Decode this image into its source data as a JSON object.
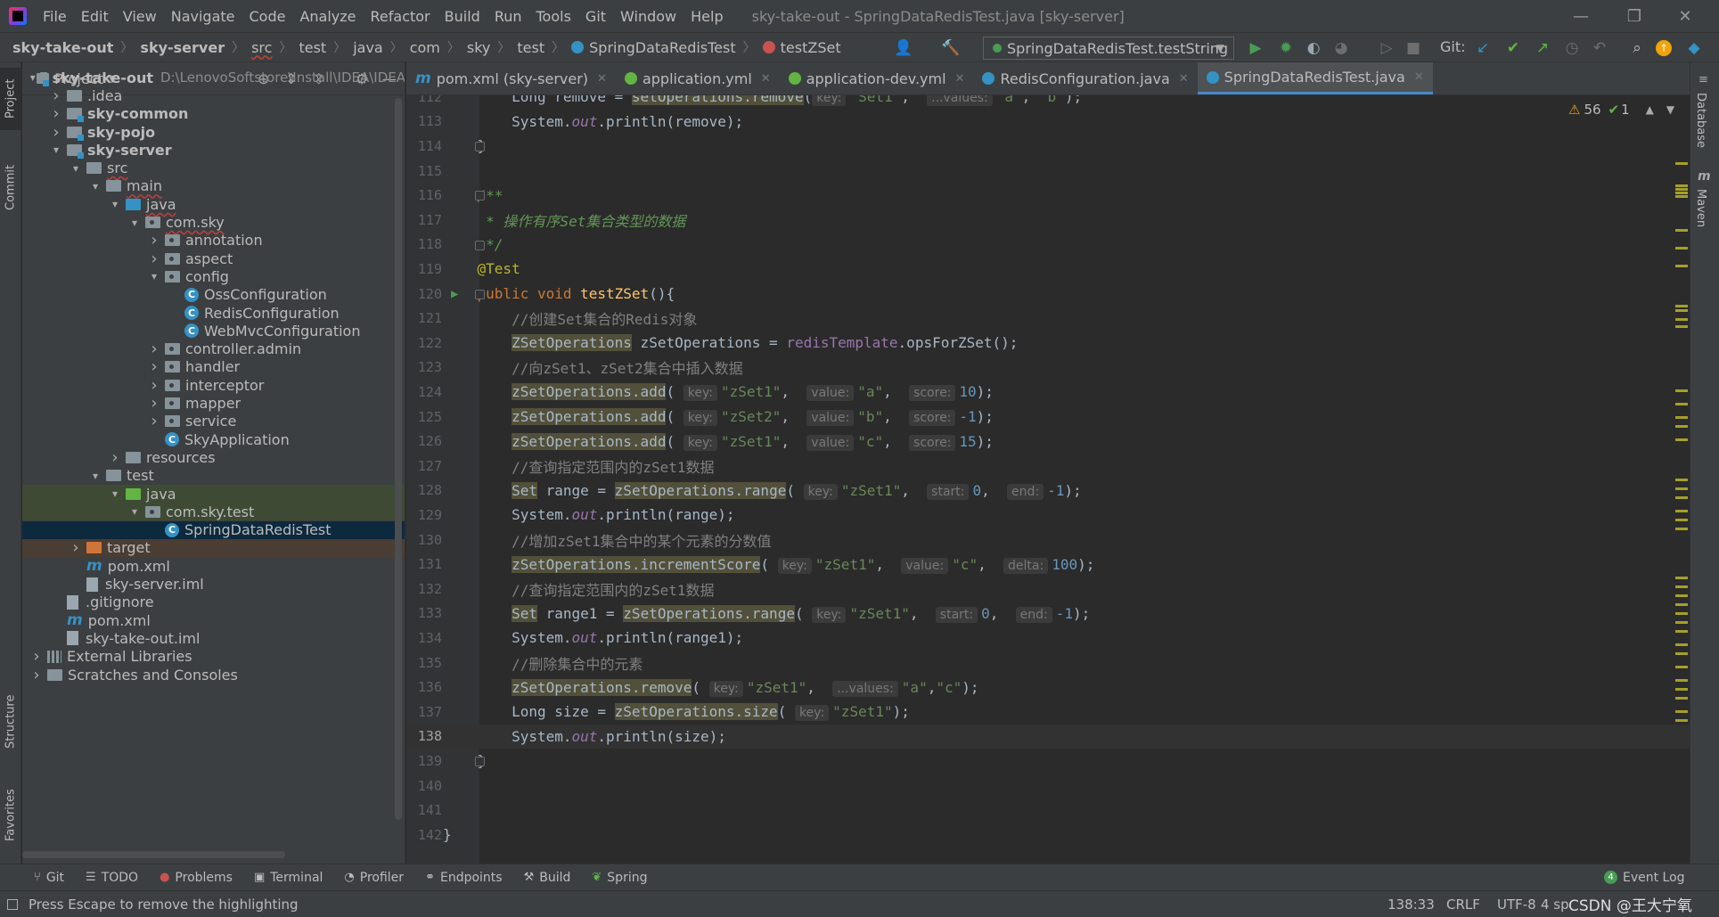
{
  "menubar": {
    "items": [
      "File",
      "Edit",
      "View",
      "Navigate",
      "Code",
      "Analyze",
      "Refactor",
      "Build",
      "Run",
      "Tools",
      "Git",
      "Window",
      "Help"
    ],
    "title": "sky-take-out - SpringDataRedisTest.java [sky-server]"
  },
  "breadcrumb": [
    "sky-take-out",
    "sky-server",
    "src",
    "test",
    "java",
    "com",
    "sky",
    "test",
    "SpringDataRedisTest",
    "testZSet"
  ],
  "toolbar": {
    "run_config": "SpringDataRedisTest.testString",
    "git_label": "Git:"
  },
  "project": {
    "header": "Project",
    "tree": [
      {
        "label": "sky-take-out",
        "extra": "D:\\LenovoSoftstore\\Install\\IDEA\\IDEA",
        "depth": 0,
        "arrow": "down",
        "icon": "module",
        "bold": true
      },
      {
        "label": ".idea",
        "depth": 1,
        "arrow": "right",
        "icon": "plain"
      },
      {
        "label": "sky-common",
        "depth": 1,
        "arrow": "right",
        "icon": "module",
        "bold": true
      },
      {
        "label": "sky-pojo",
        "depth": 1,
        "arrow": "right",
        "icon": "module",
        "bold": true
      },
      {
        "label": "sky-server",
        "depth": 1,
        "arrow": "down",
        "icon": "module",
        "bold": true
      },
      {
        "label": "src",
        "depth": 2,
        "arrow": "down",
        "icon": "plain"
      },
      {
        "label": "main",
        "depth": 3,
        "arrow": "down",
        "icon": "plain"
      },
      {
        "label": "java",
        "depth": 4,
        "arrow": "down",
        "icon": "blue"
      },
      {
        "label": "com.sky",
        "depth": 5,
        "arrow": "down",
        "icon": "pkg"
      },
      {
        "label": "annotation",
        "depth": 6,
        "arrow": "right",
        "icon": "pkg"
      },
      {
        "label": "aspect",
        "depth": 6,
        "arrow": "right",
        "icon": "pkg"
      },
      {
        "label": "config",
        "depth": 6,
        "arrow": "down",
        "icon": "pkg"
      },
      {
        "label": "OssConfiguration",
        "depth": 7,
        "icon": "class"
      },
      {
        "label": "RedisConfiguration",
        "depth": 7,
        "icon": "class"
      },
      {
        "label": "WebMvcConfiguration",
        "depth": 7,
        "icon": "class"
      },
      {
        "label": "controller.admin",
        "depth": 6,
        "arrow": "right",
        "icon": "pkg"
      },
      {
        "label": "handler",
        "depth": 6,
        "arrow": "right",
        "icon": "pkg"
      },
      {
        "label": "interceptor",
        "depth": 6,
        "arrow": "right",
        "icon": "pkg"
      },
      {
        "label": "mapper",
        "depth": 6,
        "arrow": "right",
        "icon": "pkg"
      },
      {
        "label": "service",
        "depth": 6,
        "arrow": "right",
        "icon": "pkg"
      },
      {
        "label": "SkyApplication",
        "depth": 6,
        "icon": "class"
      },
      {
        "label": "resources",
        "depth": 4,
        "arrow": "right",
        "icon": "plain"
      },
      {
        "label": "test",
        "depth": 3,
        "arrow": "down",
        "icon": "plain"
      },
      {
        "label": "java",
        "depth": 4,
        "arrow": "down",
        "icon": "green",
        "tint": "green"
      },
      {
        "label": "com.sky.test",
        "depth": 5,
        "arrow": "down",
        "icon": "pkg",
        "tint": "green"
      },
      {
        "label": "SpringDataRedisTest",
        "depth": 6,
        "icon": "class",
        "tint": "selected"
      },
      {
        "label": "target",
        "depth": 2,
        "arrow": "right",
        "icon": "orange",
        "tint": "orange"
      },
      {
        "label": "pom.xml",
        "depth": 2,
        "icon": "m"
      },
      {
        "label": "sky-server.iml",
        "depth": 2,
        "icon": "file"
      },
      {
        "label": ".gitignore",
        "depth": 1,
        "icon": "file"
      },
      {
        "label": "pom.xml",
        "depth": 1,
        "icon": "m"
      },
      {
        "label": "sky-take-out.iml",
        "depth": 1,
        "icon": "file"
      },
      {
        "label": "External Libraries",
        "depth": 0,
        "arrow": "right",
        "icon": "lib"
      },
      {
        "label": "Scratches and Consoles",
        "depth": 0,
        "arrow": "right",
        "icon": "scratch"
      }
    ]
  },
  "tabs": [
    {
      "label": "pom.xml (sky-server)",
      "icon": "m",
      "active": false
    },
    {
      "label": "application.yml",
      "icon": "yml",
      "active": false
    },
    {
      "label": "application-dev.yml",
      "icon": "yml",
      "active": false
    },
    {
      "label": "RedisConfiguration.java",
      "icon": "class",
      "active": false
    },
    {
      "label": "SpringDataRedisTest.java",
      "icon": "class",
      "active": true
    }
  ],
  "editor": {
    "warnings": "56",
    "checks": "1",
    "lines": [
      {
        "n": "112",
        "parts": [
          [
            "",
            "        Long remove = "
          ],
          [
            "hl",
            "setOperations.remove"
          ],
          [
            "",
            "("
          ],
          [
            "hint",
            "key:"
          ],
          [
            "str",
            "\"Set1\""
          ],
          [
            "",
            ",  "
          ],
          [
            "hint",
            "...values:"
          ],
          [
            "str",
            "\"a\""
          ],
          [
            "",
            ", "
          ],
          [
            "str",
            "\"b\""
          ],
          [
            "",
            ");"
          ]
        ]
      },
      {
        "n": "113",
        "parts": [
          [
            "",
            "        System."
          ],
          [
            "ital",
            "out"
          ],
          [
            "",
            ".println(remove);"
          ]
        ]
      },
      {
        "n": "114",
        "parts": [
          [
            "",
            "    }"
          ]
        ]
      },
      {
        "n": "115",
        "parts": []
      },
      {
        "n": "116",
        "parts": [
          [
            "doc",
            "    /**"
          ]
        ]
      },
      {
        "n": "117",
        "parts": [
          [
            "doc",
            "     * 操作有序Set集合类型的数据"
          ]
        ]
      },
      {
        "n": "118",
        "parts": [
          [
            "doc",
            "     */"
          ]
        ]
      },
      {
        "n": "119",
        "parts": [
          [
            "ann",
            "    @Test"
          ]
        ]
      },
      {
        "n": "120",
        "parts": [
          [
            "kw",
            "    public void "
          ],
          [
            "fnd",
            "testZSet"
          ],
          [
            "",
            "(){"
          ]
        ]
      },
      {
        "n": "121",
        "parts": [
          [
            "cmt",
            "        //创建Set集合的Redis对象"
          ]
        ]
      },
      {
        "n": "122",
        "parts": [
          [
            "",
            "        "
          ],
          [
            "hl",
            "ZSetOperations"
          ],
          [
            "",
            " zSetOperations = "
          ],
          [
            "fld",
            "redisTemplate"
          ],
          [
            "",
            ".opsForZSet();"
          ]
        ]
      },
      {
        "n": "123",
        "parts": [
          [
            "cmt",
            "        //向zSet1、zSet2集合中插入数据"
          ]
        ]
      },
      {
        "n": "124",
        "parts": [
          [
            "",
            "        "
          ],
          [
            "hl",
            "zSetOperations.add"
          ],
          [
            "",
            "( "
          ],
          [
            "hint",
            "key:"
          ],
          [
            "str",
            "\"zSet1\""
          ],
          [
            "",
            ",  "
          ],
          [
            "hint",
            "value:"
          ],
          [
            "str",
            "\"a\""
          ],
          [
            "",
            ",  "
          ],
          [
            "hint",
            "score:"
          ],
          [
            "num",
            "10"
          ],
          [
            "",
            ");"
          ]
        ]
      },
      {
        "n": "125",
        "parts": [
          [
            "",
            "        "
          ],
          [
            "hl",
            "zSetOperations.add"
          ],
          [
            "",
            "( "
          ],
          [
            "hint",
            "key:"
          ],
          [
            "str",
            "\"zSet2\""
          ],
          [
            "",
            ",  "
          ],
          [
            "hint",
            "value:"
          ],
          [
            "str",
            "\"b\""
          ],
          [
            "",
            ",  "
          ],
          [
            "hint",
            "score:"
          ],
          [
            "num",
            "-1"
          ],
          [
            "",
            ");"
          ]
        ]
      },
      {
        "n": "126",
        "parts": [
          [
            "",
            "        "
          ],
          [
            "hl",
            "zSetOperations.add"
          ],
          [
            "",
            "( "
          ],
          [
            "hint",
            "key:"
          ],
          [
            "str",
            "\"zSet1\""
          ],
          [
            "",
            ",  "
          ],
          [
            "hint",
            "value:"
          ],
          [
            "str",
            "\"c\""
          ],
          [
            "",
            ",  "
          ],
          [
            "hint",
            "score:"
          ],
          [
            "num",
            "15"
          ],
          [
            "",
            ");"
          ]
        ]
      },
      {
        "n": "127",
        "parts": [
          [
            "cmt",
            "        //查询指定范围内的zSet1数据"
          ]
        ]
      },
      {
        "n": "128",
        "parts": [
          [
            "",
            "        "
          ],
          [
            "hl",
            "Set"
          ],
          [
            "",
            " range = "
          ],
          [
            "hl",
            "zSetOperations.range"
          ],
          [
            "",
            "( "
          ],
          [
            "hint",
            "key:"
          ],
          [
            "str",
            "\"zSet1\""
          ],
          [
            "",
            ",  "
          ],
          [
            "hint",
            "start:"
          ],
          [
            "num",
            "0"
          ],
          [
            "",
            ",  "
          ],
          [
            "hint",
            "end:"
          ],
          [
            "num",
            "-1"
          ],
          [
            "",
            ");"
          ]
        ]
      },
      {
        "n": "129",
        "parts": [
          [
            "",
            "        System."
          ],
          [
            "ital",
            "out"
          ],
          [
            "",
            ".println(range);"
          ]
        ]
      },
      {
        "n": "130",
        "parts": [
          [
            "cmt",
            "        //增加zSet1集合中的某个元素的分数值"
          ]
        ]
      },
      {
        "n": "131",
        "parts": [
          [
            "",
            "        "
          ],
          [
            "hl",
            "zSetOperations.incrementScore"
          ],
          [
            "",
            "( "
          ],
          [
            "hint",
            "key:"
          ],
          [
            "str",
            "\"zSet1\""
          ],
          [
            "",
            ",  "
          ],
          [
            "hint",
            "value:"
          ],
          [
            "str",
            "\"c\""
          ],
          [
            "",
            ",  "
          ],
          [
            "hint",
            "delta:"
          ],
          [
            "num",
            "100"
          ],
          [
            "",
            ");"
          ]
        ]
      },
      {
        "n": "132",
        "parts": [
          [
            "cmt",
            "        //查询指定范围内的zSet1数据"
          ]
        ]
      },
      {
        "n": "133",
        "parts": [
          [
            "",
            "        "
          ],
          [
            "hl",
            "Set"
          ],
          [
            "",
            " range1 = "
          ],
          [
            "hl",
            "zSetOperations.range"
          ],
          [
            "",
            "( "
          ],
          [
            "hint",
            "key:"
          ],
          [
            "str",
            "\"zSet1\""
          ],
          [
            "",
            ",  "
          ],
          [
            "hint",
            "start:"
          ],
          [
            "num",
            "0"
          ],
          [
            "",
            ",  "
          ],
          [
            "hint",
            "end:"
          ],
          [
            "num",
            "-1"
          ],
          [
            "",
            ");"
          ]
        ]
      },
      {
        "n": "134",
        "parts": [
          [
            "",
            "        System."
          ],
          [
            "ital",
            "out"
          ],
          [
            "",
            ".println(range1);"
          ]
        ]
      },
      {
        "n": "135",
        "parts": [
          [
            "cmt",
            "        //删除集合中的元素"
          ]
        ]
      },
      {
        "n": "136",
        "parts": [
          [
            "",
            "        "
          ],
          [
            "hl",
            "zSetOperations.remove"
          ],
          [
            "",
            "( "
          ],
          [
            "hint",
            "key:"
          ],
          [
            "str",
            "\"zSet1\""
          ],
          [
            "",
            ",  "
          ],
          [
            "hint",
            "...values:"
          ],
          [
            "str",
            "\"a\""
          ],
          [
            "",
            ","
          ],
          [
            "str",
            "\"c\""
          ],
          [
            "",
            ");"
          ]
        ]
      },
      {
        "n": "137",
        "parts": [
          [
            "",
            "        Long size = "
          ],
          [
            "hl",
            "zSetOperations.size"
          ],
          [
            "",
            "( "
          ],
          [
            "hint",
            "key:"
          ],
          [
            "str",
            "\"zSet1\""
          ],
          [
            "",
            ");"
          ]
        ]
      },
      {
        "n": "138",
        "parts": [
          [
            "",
            "        System."
          ],
          [
            "ital",
            "out"
          ],
          [
            "",
            ".println(size);"
          ]
        ]
      },
      {
        "n": "139",
        "parts": [
          [
            "",
            "    }"
          ]
        ]
      },
      {
        "n": "140",
        "parts": []
      },
      {
        "n": "141",
        "parts": []
      },
      {
        "n": "142",
        "parts": [
          [
            "",
            "}"
          ]
        ]
      }
    ]
  },
  "right_tools": [
    "Database",
    "Maven"
  ],
  "left_tools": [
    "Project",
    "Commit",
    "Structure",
    "Favorites"
  ],
  "bottom_tools": [
    {
      "label": "Git",
      "icon": "git-icon"
    },
    {
      "label": "TODO",
      "icon": "list-icon"
    },
    {
      "label": "Problems",
      "icon": "error-icon"
    },
    {
      "label": "Terminal",
      "icon": "terminal-icon"
    },
    {
      "label": "Profiler",
      "icon": "profiler-icon"
    },
    {
      "label": "Endpoints",
      "icon": "endpoints-icon"
    },
    {
      "label": "Build",
      "icon": "hammer-icon"
    },
    {
      "label": "Spring",
      "icon": "leaf-icon"
    }
  ],
  "event_log": {
    "label": "Event Log",
    "count": "4"
  },
  "status": {
    "message": "Press Escape to remove the highlighting",
    "position": "138:33",
    "line_sep": "CRLF",
    "encoding": "UTF-8",
    "indent": "4 sp",
    "watermark": "CSDN @王大宁氧"
  }
}
